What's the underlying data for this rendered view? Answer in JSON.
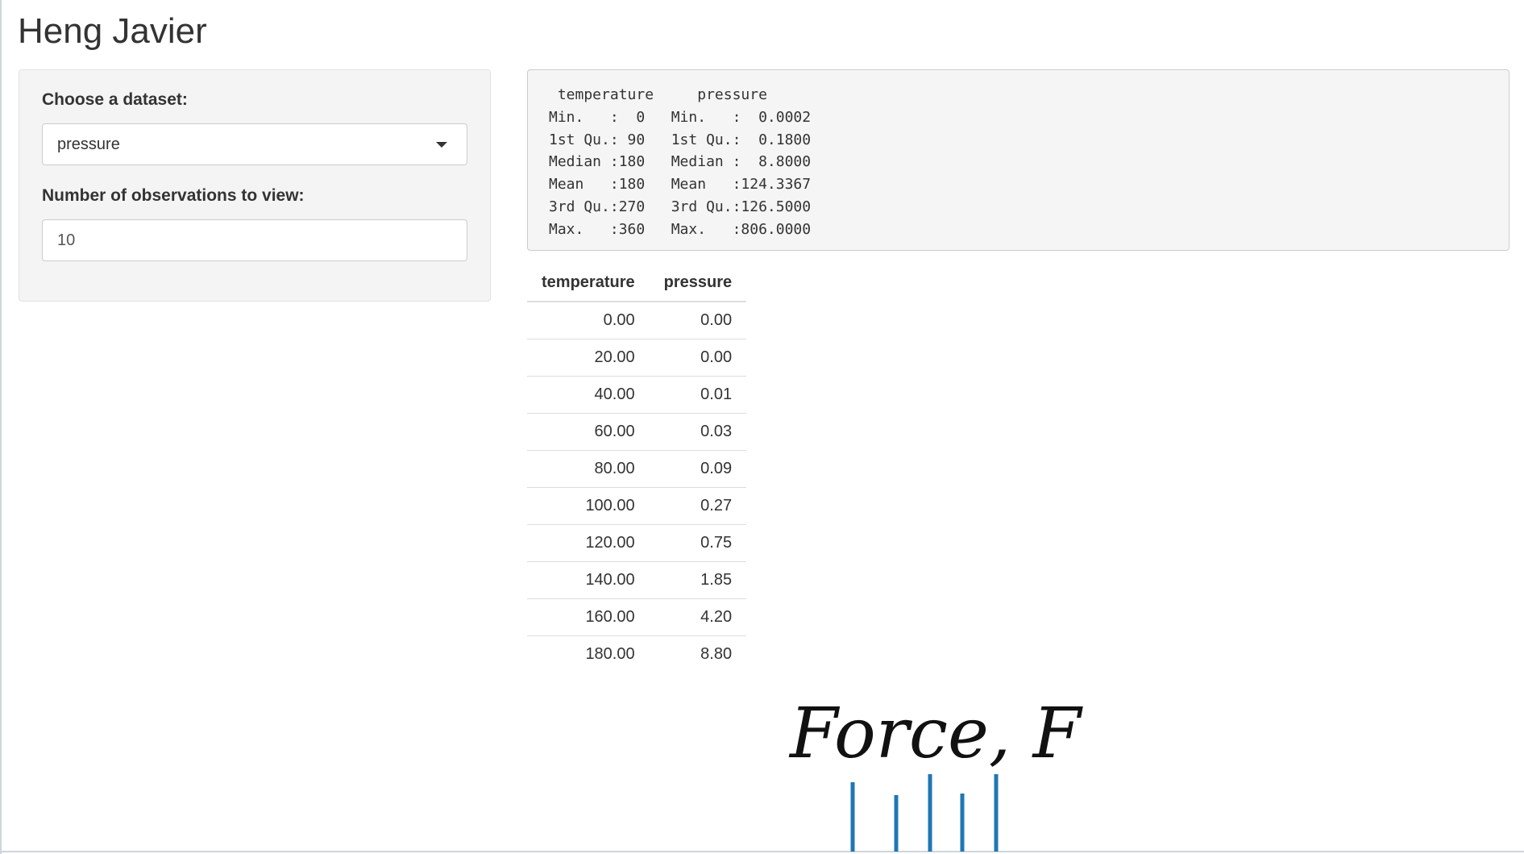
{
  "app": {
    "title": "Heng Javier"
  },
  "sidebar": {
    "dataset_label": "Choose a dataset:",
    "dataset_selected": "pressure",
    "obs_label": "Number of observations to view:",
    "obs_value": "10"
  },
  "summary": {
    "text": " temperature     pressure     \nMin.   :  0   Min.   :  0.0002  \n1st Qu.: 90   1st Qu.:  0.1800  \nMedian :180   Median :  8.8000  \nMean   :180   Mean   :124.3367  \n3rd Qu.:270   3rd Qu.:126.5000  \nMax.   :360   Max.   :806.0000  "
  },
  "table": {
    "headers": [
      "temperature",
      "pressure"
    ],
    "rows": [
      [
        "0.00",
        "0.00"
      ],
      [
        "20.00",
        "0.00"
      ],
      [
        "40.00",
        "0.01"
      ],
      [
        "60.00",
        "0.03"
      ],
      [
        "80.00",
        "0.09"
      ],
      [
        "100.00",
        "0.27"
      ],
      [
        "120.00",
        "0.75"
      ],
      [
        "140.00",
        "1.85"
      ],
      [
        "160.00",
        "4.20"
      ],
      [
        "180.00",
        "8.80"
      ]
    ]
  },
  "figure": {
    "label": "Force, F",
    "bar_color": "#1f77b4"
  },
  "colors": {
    "panel_bg": "#f4f4f4",
    "summary_bg": "#f5f5f5",
    "border": "#cccccc"
  }
}
